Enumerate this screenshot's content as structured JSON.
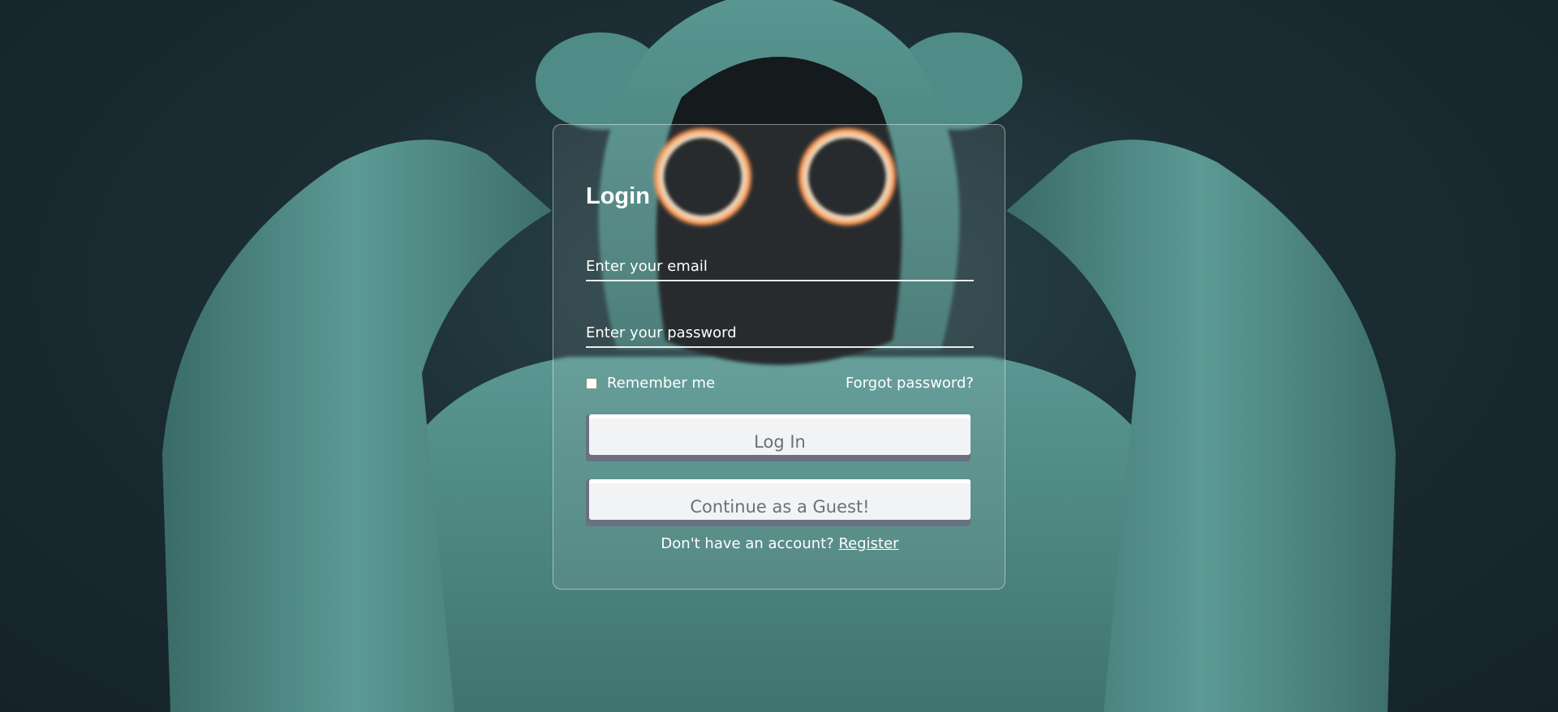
{
  "login_form": {
    "title": "Login",
    "email_placeholder": "Enter your email",
    "password_placeholder": "Enter your password",
    "remember_label": "Remember me",
    "forgot_link": "Forgot password?",
    "login_button": "Log In",
    "guest_button": "Continue as a Guest!",
    "register_prompt": "Don't have an account? ",
    "register_link": "Register"
  },
  "colors": {
    "background": "#1b2d33",
    "hoodie": "#4f8f8c",
    "eye_glow": "#ff9a52",
    "button_bg": "#f2f3f5",
    "button_text": "#6b6f78"
  },
  "icons": {
    "remember_checkbox": "checkbox-unchecked-icon"
  }
}
